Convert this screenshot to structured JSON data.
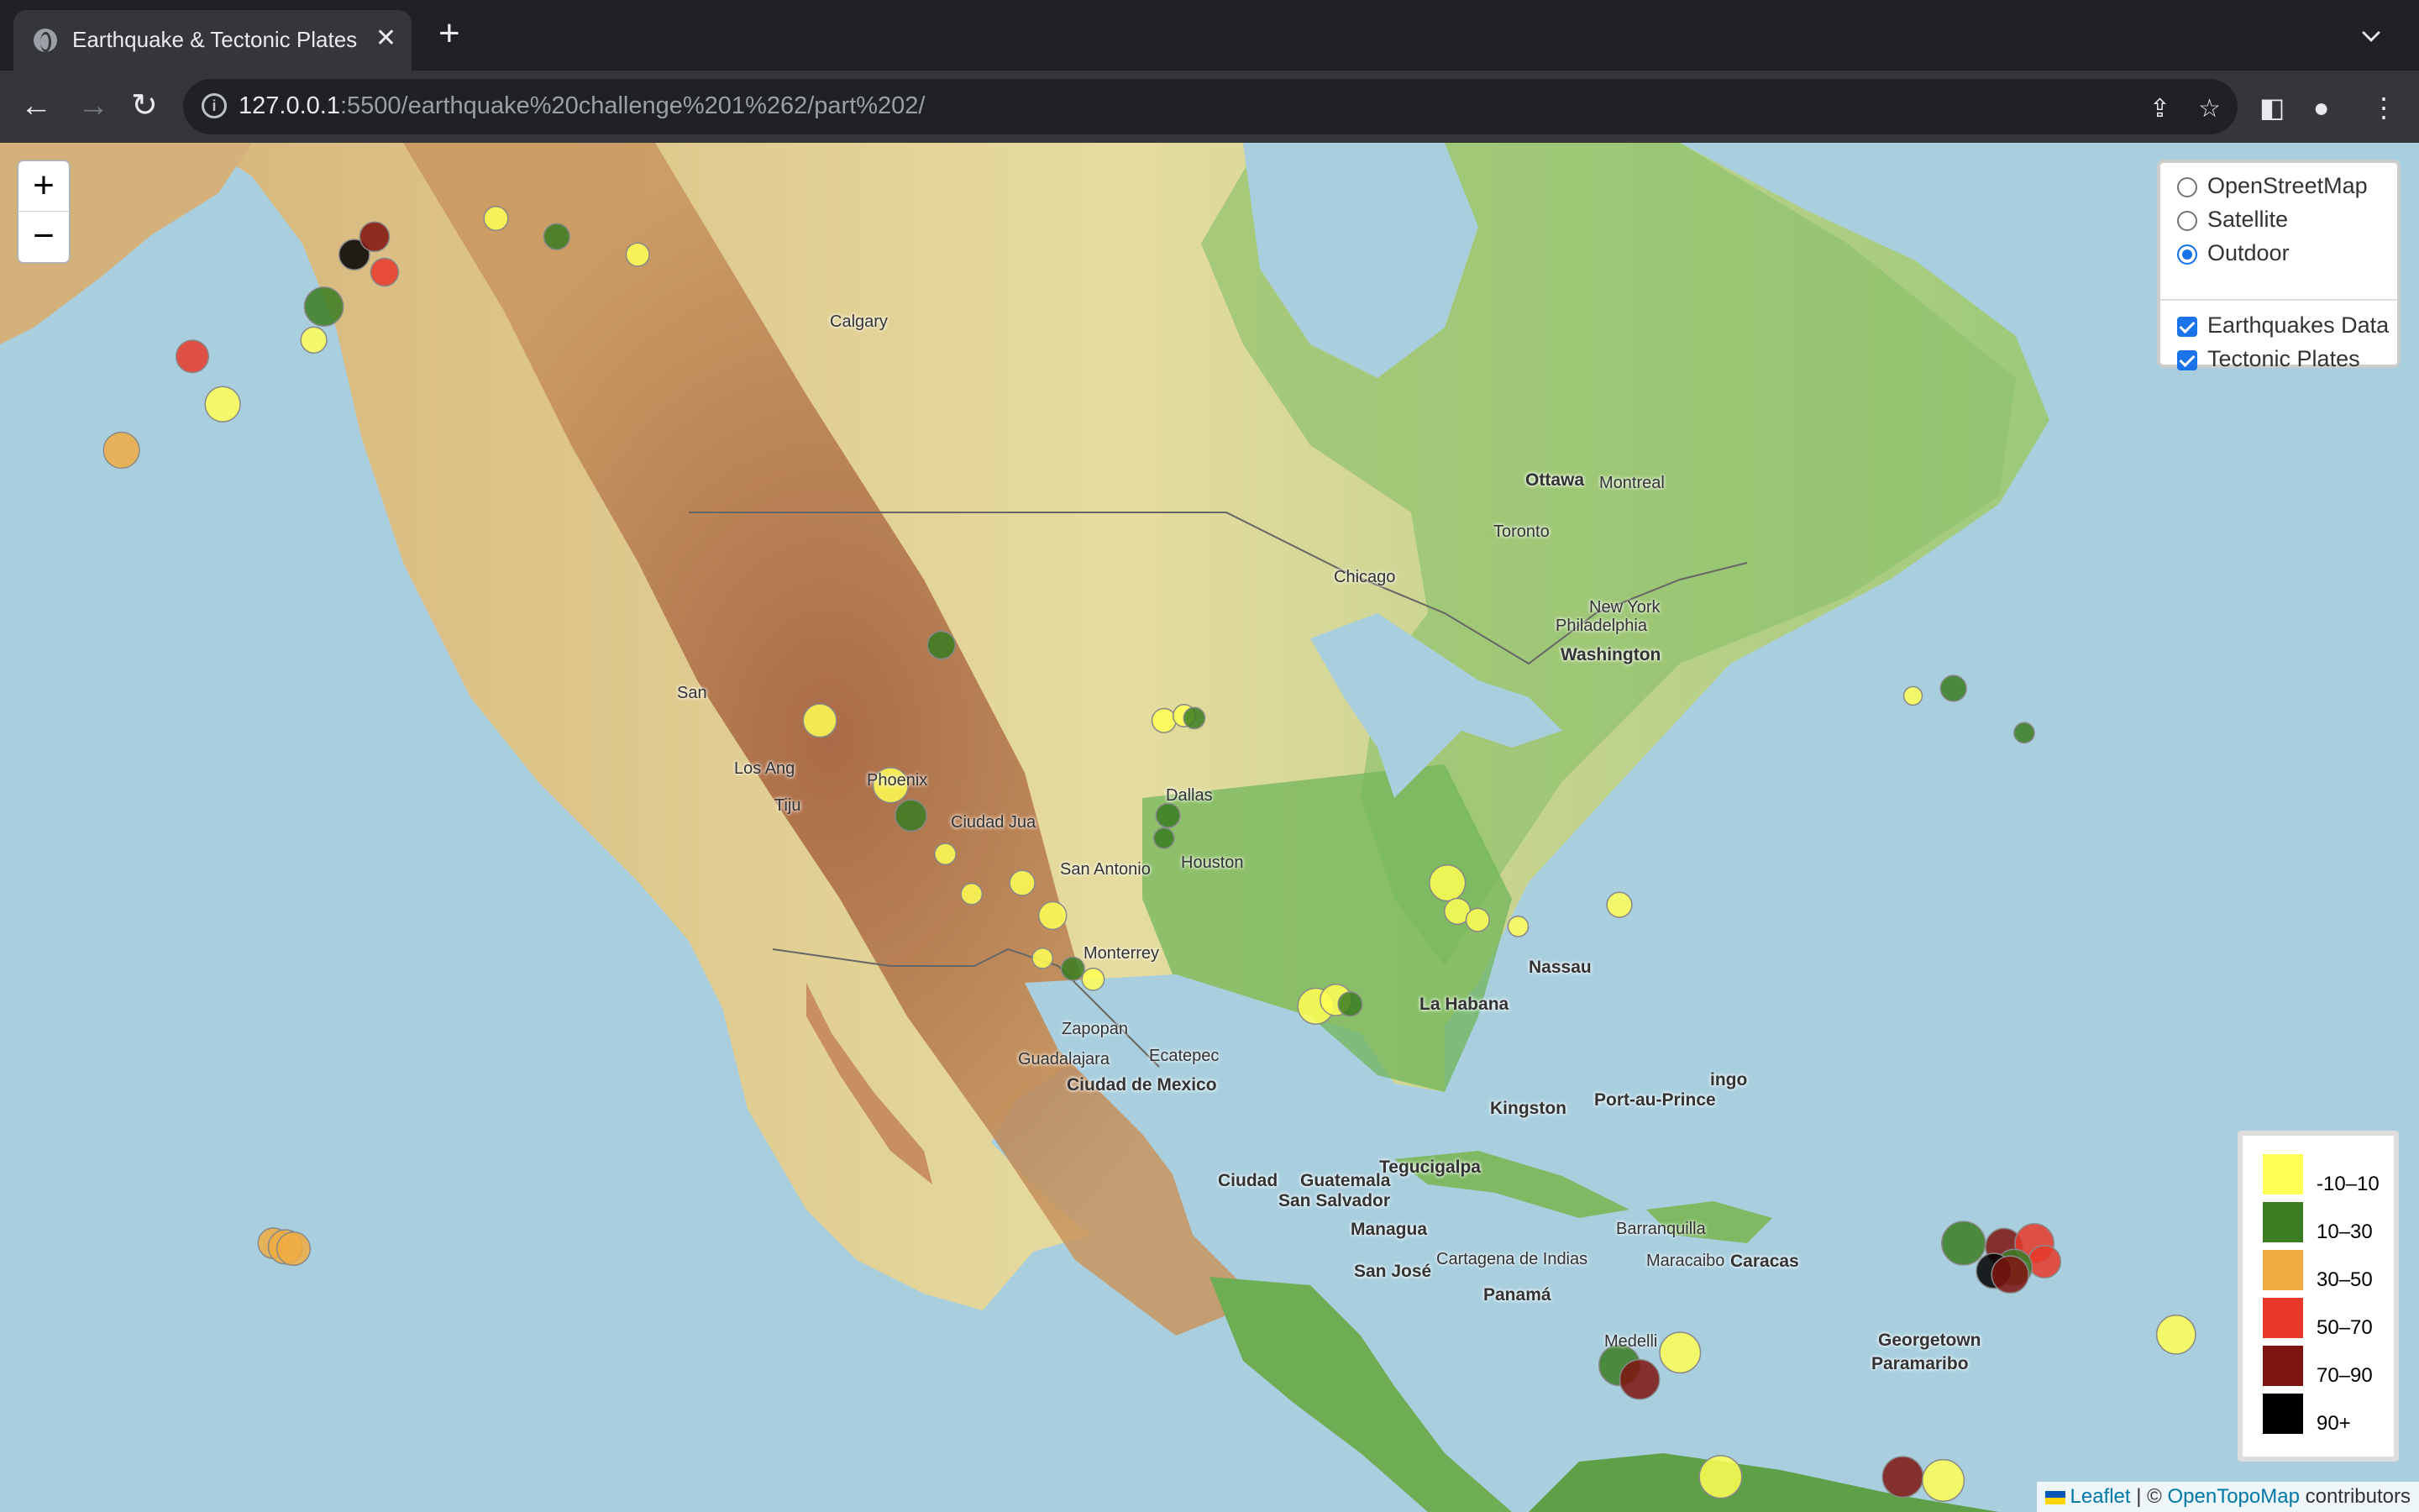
{
  "browser": {
    "tab_title": "Earthquake & Tectonic Plates",
    "url_host": "127.0.0.1",
    "url_rest": ":5500/earthquake%20challenge%201%262/part%202/"
  },
  "map": {
    "zoom_in": "+",
    "zoom_out": "−",
    "base_layers": [
      {
        "label": "OpenStreetMap",
        "selected": false
      },
      {
        "label": "Satellite",
        "selected": false
      },
      {
        "label": "Outdoor",
        "selected": true
      }
    ],
    "overlays": [
      {
        "label": "Earthquakes Data",
        "checked": true
      },
      {
        "label": "Tectonic Plates",
        "checked": true
      }
    ],
    "legend": [
      {
        "label": "-10–10",
        "color": "#ffff55"
      },
      {
        "label": "10–30",
        "color": "#3a7d22"
      },
      {
        "label": "30–50",
        "color": "#f0ac42"
      },
      {
        "label": "50–70",
        "color": "#e8382a"
      },
      {
        "label": "70–90",
        "color": "#7e140f"
      },
      {
        "label": "90+",
        "color": "#000000"
      }
    ],
    "attribution": {
      "leaflet": "Leaflet",
      "sep": " | © ",
      "provider": "OpenTopoMap",
      "suffix": " contributors"
    },
    "cities": [
      {
        "name": "Calgary",
        "bold": false
      },
      {
        "name": "Ottawa",
        "bold": true
      },
      {
        "name": "Montreal",
        "bold": false
      },
      {
        "name": "Toronto",
        "bold": false
      },
      {
        "name": "Chicago",
        "bold": false
      },
      {
        "name": "New York",
        "bold": false
      },
      {
        "name": "Philadelphia",
        "bold": false
      },
      {
        "name": "Washington",
        "bold": true
      },
      {
        "name": "San",
        "bold": false
      },
      {
        "name": "Los Ang",
        "bold": false
      },
      {
        "name": "Tiju",
        "bold": false
      },
      {
        "name": "Phoenix",
        "bold": false
      },
      {
        "name": "Ciudad Jua",
        "bold": false
      },
      {
        "name": "Dallas",
        "bold": false
      },
      {
        "name": "San Antonio",
        "bold": false
      },
      {
        "name": "Houston",
        "bold": false
      },
      {
        "name": "Monterrey",
        "bold": false
      },
      {
        "name": "Nassau",
        "bold": true
      },
      {
        "name": "La Habana",
        "bold": true
      },
      {
        "name": "Zapopan",
        "bold": false
      },
      {
        "name": "Guadalajara",
        "bold": false
      },
      {
        "name": "Ecatepec",
        "bold": false
      },
      {
        "name": "Ciudad de Mexico",
        "bold": true
      },
      {
        "name": "Kingston",
        "bold": true
      },
      {
        "name": "Port-au-Prince",
        "bold": true
      },
      {
        "name": "ingo",
        "bold": true
      },
      {
        "name": "Tegucigalpa",
        "bold": true
      },
      {
        "name": "Ciudad",
        "bold": true
      },
      {
        "name": "Guatemala",
        "bold": true
      },
      {
        "name": "San Salvador",
        "bold": true
      },
      {
        "name": "Managua",
        "bold": true
      },
      {
        "name": "San José",
        "bold": true
      },
      {
        "name": "Panamá",
        "bold": true
      },
      {
        "name": "Cartagena de Indias",
        "bold": false
      },
      {
        "name": "Barranquilla",
        "bold": false
      },
      {
        "name": "Maracaibo",
        "bold": false
      },
      {
        "name": "Caracas",
        "bold": true
      },
      {
        "name": "Georgetown",
        "bold": true
      },
      {
        "name": "Paramaribo",
        "bold": true
      },
      {
        "name": "Medelli",
        "bold": false
      }
    ],
    "quakes": [
      {
        "lon": -122.8,
        "lat": 38.8,
        "depth": 2,
        "mag": 2.3
      },
      {
        "lon": -118.0,
        "lat": 34.0,
        "depth": 8,
        "mag": 2.2
      },
      {
        "lon": -116.5,
        "lat": 33.5,
        "depth": 12,
        "mag": 2.5
      },
      {
        "lon": -115.5,
        "lat": 33.0,
        "depth": 5,
        "mag": 2.4
      },
      {
        "lon": -117.5,
        "lat": 36.0,
        "depth": 3,
        "mag": 3.0
      },
      {
        "lon": -119.0,
        "lat": 37.5,
        "depth": 4,
        "mag": 2.7
      },
      {
        "lon": -121.5,
        "lat": 37.0,
        "depth": 6,
        "mag": 2.3
      },
      {
        "lon": -124.5,
        "lat": 40.5,
        "depth": 20,
        "mag": 3.4
      },
      {
        "lon": -125.5,
        "lat": 41.8,
        "depth": 5,
        "mag": 3.8
      },
      {
        "lon": -129.0,
        "lat": 44.5,
        "depth": 7,
        "mag": 3.6
      },
      {
        "lon": -123.0,
        "lat": 47.5,
        "depth": 25,
        "mag": 3.0
      },
      {
        "lon": -112.0,
        "lat": 44.5,
        "depth": 5,
        "mag": 2.6
      },
      {
        "lon": -111.0,
        "lat": 44.7,
        "depth": 8,
        "mag": 2.4
      },
      {
        "lon": -110.5,
        "lat": 44.6,
        "depth": 15,
        "mag": 2.3
      },
      {
        "lon": -112.0,
        "lat": 39.5,
        "depth": 10,
        "mag": 2.2
      },
      {
        "lon": -111.8,
        "lat": 40.5,
        "depth": 12,
        "mag": 2.6
      },
      {
        "lon": -104.5,
        "lat": 31.7,
        "depth": 6,
        "mag": 3.9
      },
      {
        "lon": -103.5,
        "lat": 32.0,
        "depth": 4,
        "mag": 3.4
      },
      {
        "lon": -102.8,
        "lat": 31.8,
        "depth": 20,
        "mag": 2.6
      },
      {
        "lon": -98.0,
        "lat": 37.5,
        "depth": 5,
        "mag": 3.9
      },
      {
        "lon": -97.5,
        "lat": 36.2,
        "depth": 4,
        "mag": 2.8
      },
      {
        "lon": -96.5,
        "lat": 35.8,
        "depth": 3,
        "mag": 2.5
      },
      {
        "lon": -94.5,
        "lat": 35.5,
        "depth": 7,
        "mag": 2.2
      },
      {
        "lon": -89.5,
        "lat": 36.5,
        "depth": 8,
        "mag": 2.7
      },
      {
        "lon": -73.0,
        "lat": 45.8,
        "depth": 15,
        "mag": 2.8
      },
      {
        "lon": -75.0,
        "lat": 45.5,
        "depth": 5,
        "mag": 2.0
      },
      {
        "lon": -69.5,
        "lat": 44.0,
        "depth": 15,
        "mag": 2.2
      },
      {
        "lon": -72.5,
        "lat": 19.5,
        "depth": 20,
        "mag": 4.7
      },
      {
        "lon": -70.5,
        "lat": 19.3,
        "depth": 80,
        "mag": 4.0
      },
      {
        "lon": -69.0,
        "lat": 19.5,
        "depth": 60,
        "mag": 4.2
      },
      {
        "lon": -68.5,
        "lat": 18.5,
        "depth": 55,
        "mag": 3.5
      },
      {
        "lon": -70.0,
        "lat": 18.2,
        "depth": 20,
        "mag": 3.9
      },
      {
        "lon": -71.0,
        "lat": 18.0,
        "depth": 95,
        "mag": 3.8
      },
      {
        "lon": -70.2,
        "lat": 17.8,
        "depth": 75,
        "mag": 4.0
      },
      {
        "lon": -62.0,
        "lat": 14.5,
        "depth": 8,
        "mag": 4.2
      },
      {
        "lon": -86.5,
        "lat": 13.5,
        "depth": 5,
        "mag": 4.4
      },
      {
        "lon": -89.5,
        "lat": 12.8,
        "depth": 20,
        "mag": 4.4
      },
      {
        "lon": -88.5,
        "lat": 12.0,
        "depth": 75,
        "mag": 4.3
      },
      {
        "lon": -84.5,
        "lat": 6.5,
        "depth": 5,
        "mag": 4.6
      },
      {
        "lon": -75.5,
        "lat": 6.5,
        "depth": 80,
        "mag": 4.4
      },
      {
        "lon": -73.5,
        "lat": 6.3,
        "depth": 5,
        "mag": 4.5
      },
      {
        "lon": -156.0,
        "lat": 19.5,
        "depth": 35,
        "mag": 3.3
      },
      {
        "lon": -155.4,
        "lat": 19.3,
        "depth": 38,
        "mag": 3.7
      },
      {
        "lon": -155.0,
        "lat": 19.2,
        "depth": 32,
        "mag": 3.6
      },
      {
        "lon": -158.5,
        "lat": 56.0,
        "depth": 5,
        "mag": 3.8
      },
      {
        "lon": -160.0,
        "lat": 57.5,
        "depth": 55,
        "mag": 3.5
      },
      {
        "lon": -163.5,
        "lat": 54.5,
        "depth": 38,
        "mag": 3.9
      },
      {
        "lon": -153.5,
        "lat": 59.0,
        "depth": 20,
        "mag": 4.2
      },
      {
        "lon": -152.0,
        "lat": 60.5,
        "depth": 95,
        "mag": 3.3
      },
      {
        "lon": -151.0,
        "lat": 61.0,
        "depth": 70,
        "mag": 3.2
      },
      {
        "lon": -150.5,
        "lat": 60.0,
        "depth": 55,
        "mag": 3.0
      },
      {
        "lon": -154.0,
        "lat": 58.0,
        "depth": 5,
        "mag": 2.8
      },
      {
        "lon": -145.0,
        "lat": 61.5,
        "depth": 5,
        "mag": 2.6
      },
      {
        "lon": -142.0,
        "lat": 61.0,
        "depth": 15,
        "mag": 2.8
      },
      {
        "lon": -138.0,
        "lat": 60.5,
        "depth": 5,
        "mag": 2.5
      }
    ]
  }
}
